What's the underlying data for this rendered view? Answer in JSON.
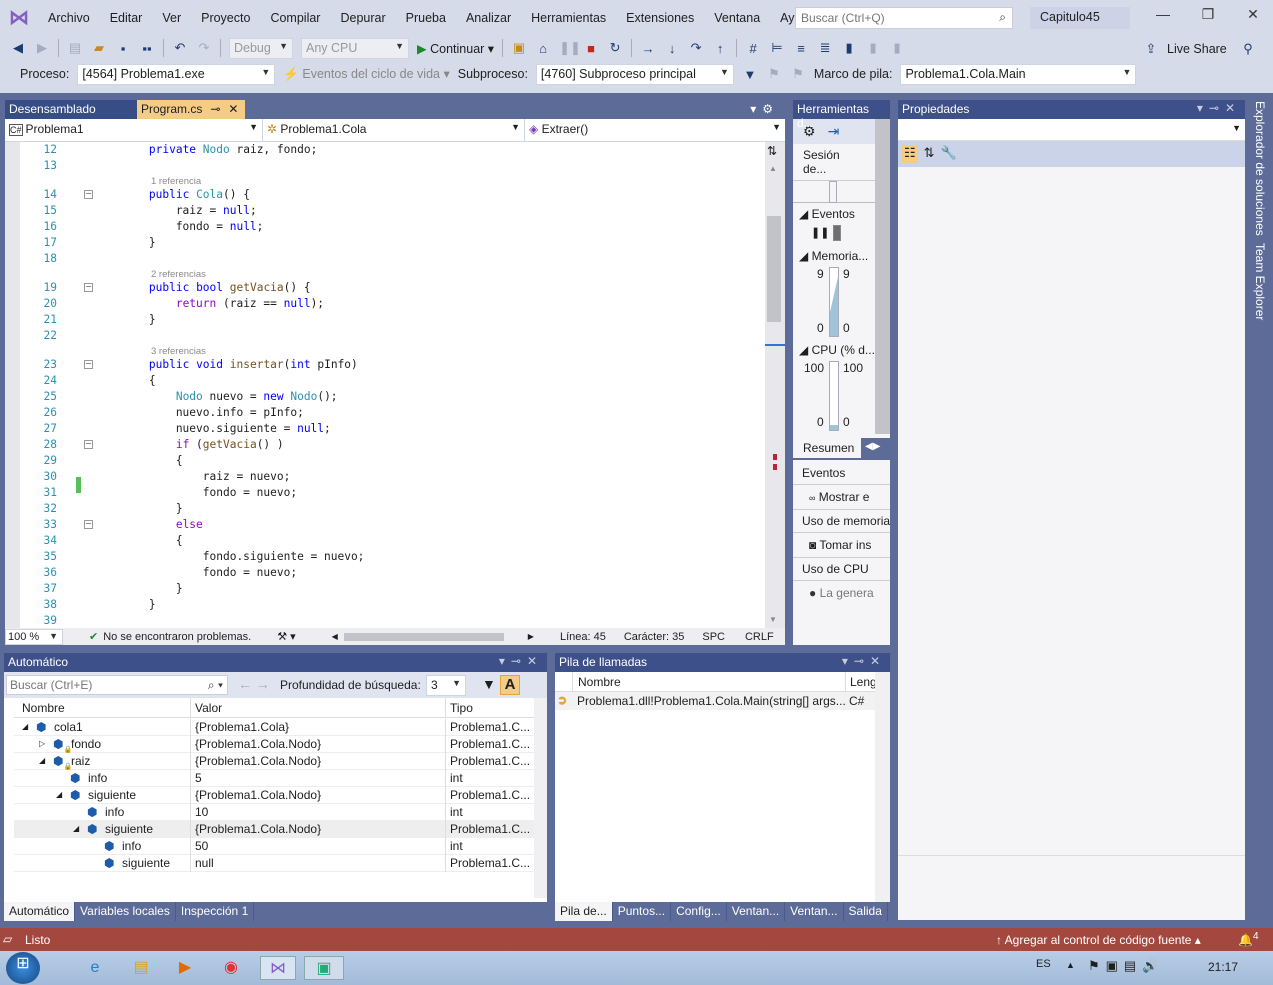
{
  "menu": {
    "items": [
      "Archivo",
      "Editar",
      "Ver",
      "Proyecto",
      "Compilar",
      "Depurar",
      "Prueba",
      "Analizar",
      "Herramientas",
      "Extensiones",
      "Ventana",
      "Ayuda"
    ],
    "search_placeholder": "Buscar (Ctrl+Q)",
    "project": "Capitulo45"
  },
  "toolbar": {
    "config": "Debug",
    "platform": "Any CPU",
    "continue": "Continuar",
    "live_share": "Live Share"
  },
  "debugbar": {
    "process_label": "Proceso:",
    "process": "[4564] Problema1.exe",
    "lifecycle": "Eventos del ciclo de vida",
    "thread_label": "Subproceso:",
    "thread": "[4760] Subproceso principal",
    "frame_label": "Marco de pila:",
    "frame": "Problema1.Cola.Main"
  },
  "editor": {
    "tabs": [
      {
        "label": "Desensamblado"
      },
      {
        "label": "Program.cs",
        "active": true
      }
    ],
    "nav": [
      "Problema1",
      "Problema1.Cola",
      "Extraer()"
    ],
    "lines": [
      {
        "n": "12",
        "t": [
          [
            "        "
          ],
          [
            "private",
            "k"
          ],
          [
            " "
          ],
          [
            "Nodo",
            "t"
          ],
          [
            " raiz, fondo;"
          ]
        ]
      },
      {
        "n": "13",
        "t": []
      },
      {
        "lens": "1 referencia"
      },
      {
        "n": "14",
        "fold": true,
        "t": [
          [
            "        "
          ],
          [
            "public",
            "k"
          ],
          [
            " "
          ],
          [
            "Cola",
            "t"
          ],
          [
            "() {"
          ]
        ]
      },
      {
        "n": "15",
        "t": [
          [
            "            raiz = "
          ],
          [
            "null",
            "k"
          ],
          [
            ";"
          ]
        ]
      },
      {
        "n": "16",
        "t": [
          [
            "            fondo = "
          ],
          [
            "null",
            "k"
          ],
          [
            ";"
          ]
        ]
      },
      {
        "n": "17",
        "t": [
          [
            "        }"
          ]
        ]
      },
      {
        "n": "18",
        "t": []
      },
      {
        "lens": "2 referencias"
      },
      {
        "n": "19",
        "fold": true,
        "t": [
          [
            "        "
          ],
          [
            "public",
            "k"
          ],
          [
            " "
          ],
          [
            "bool",
            "k"
          ],
          [
            " "
          ],
          [
            "getVacia",
            "m"
          ],
          [
            "() {"
          ]
        ]
      },
      {
        "n": "20",
        "t": [
          [
            "            "
          ],
          [
            "return",
            "c"
          ],
          [
            " (raiz == "
          ],
          [
            "null",
            "k"
          ],
          [
            ");"
          ]
        ]
      },
      {
        "n": "21",
        "t": [
          [
            "        }"
          ]
        ]
      },
      {
        "n": "22",
        "t": []
      },
      {
        "lens": "3 referencias"
      },
      {
        "n": "23",
        "fold": true,
        "t": [
          [
            "        "
          ],
          [
            "public",
            "k"
          ],
          [
            " "
          ],
          [
            "void",
            "k"
          ],
          [
            " "
          ],
          [
            "insertar",
            "m"
          ],
          [
            "("
          ],
          [
            "int",
            "k"
          ],
          [
            " pInfo)"
          ]
        ]
      },
      {
        "n": "24",
        "t": [
          [
            "        {"
          ]
        ]
      },
      {
        "n": "25",
        "t": [
          [
            "            "
          ],
          [
            "Nodo",
            "t"
          ],
          [
            " nuevo = "
          ],
          [
            "new",
            "k"
          ],
          [
            " "
          ],
          [
            "Nodo",
            "t"
          ],
          [
            "();"
          ]
        ]
      },
      {
        "n": "26",
        "t": [
          [
            "            nuevo.info = pInfo;"
          ]
        ]
      },
      {
        "n": "27",
        "t": [
          [
            "            nuevo.siguiente = "
          ],
          [
            "null",
            "k"
          ],
          [
            ";"
          ]
        ]
      },
      {
        "n": "28",
        "fold": true,
        "t": [
          [
            "            "
          ],
          [
            "if",
            "c"
          ],
          [
            " ("
          ],
          [
            "getVacia",
            "m"
          ],
          [
            "() )"
          ]
        ]
      },
      {
        "n": "29",
        "t": [
          [
            "            {"
          ]
        ]
      },
      {
        "n": "30",
        "t": [
          [
            "                raiz = nuevo;"
          ]
        ]
      },
      {
        "n": "31",
        "t": [
          [
            "                fondo = nuevo;"
          ]
        ]
      },
      {
        "n": "32",
        "t": [
          [
            "            }"
          ]
        ]
      },
      {
        "n": "33",
        "fold": true,
        "t": [
          [
            "            "
          ],
          [
            "else",
            "c"
          ]
        ]
      },
      {
        "n": "34",
        "t": [
          [
            "            {"
          ]
        ]
      },
      {
        "n": "35",
        "t": [
          [
            "                fondo.siguiente = nuevo;"
          ]
        ]
      },
      {
        "n": "36",
        "t": [
          [
            "                fondo = nuevo;"
          ]
        ]
      },
      {
        "n": "37",
        "t": [
          [
            "            }"
          ]
        ]
      },
      {
        "n": "38",
        "t": [
          [
            "        }"
          ]
        ]
      },
      {
        "n": "39",
        "t": []
      }
    ],
    "status": {
      "zoom": "100 %",
      "issues": "No se encontraron problemas.",
      "line": "Línea: 45",
      "char": "Carácter: 35",
      "spc": "SPC",
      "crlf": "CRLF"
    }
  },
  "diag": {
    "title": "Herramientas d...",
    "session": "Sesión de...",
    "events": "Eventos",
    "memory": "Memoria...",
    "mem_max_l": "9",
    "mem_max_r": "9",
    "mem_min_l": "0",
    "mem_min_r": "0",
    "cpu": "CPU (% d...",
    "cpu_max_l": "100",
    "cpu_max_r": "100",
    "cpu_min_l": "0",
    "cpu_min_r": "0",
    "tab": "Resumen",
    "s1": "Eventos",
    "s1a": "Mostrar e",
    "s2": "Uso de memoria",
    "s2a": "Tomar ins",
    "s3": "Uso de CPU",
    "s3a": "La genera"
  },
  "props": {
    "title": "Propiedades"
  },
  "side_tabs": [
    "Explorador de soluciones",
    "Team Explorer"
  ],
  "autos": {
    "title": "Automático",
    "search_placeholder": "Buscar (Ctrl+E)",
    "depth_label": "Profundidad de búsqueda:",
    "depth": "3",
    "cols": [
      "Nombre",
      "Valor",
      "Tipo"
    ],
    "rows": [
      {
        "name": "cola1",
        "value": "{Problema1.Cola}",
        "type": "Problema1.C...",
        "level": 0,
        "exp": "open"
      },
      {
        "name": "fondo",
        "value": "{Problema1.Cola.Nodo}",
        "type": "Problema1.C...",
        "level": 1,
        "exp": "closed",
        "lock": true
      },
      {
        "name": "raiz",
        "value": "{Problema1.Cola.Nodo}",
        "type": "Problema1.C...",
        "level": 1,
        "exp": "open",
        "lock": true
      },
      {
        "name": "info",
        "value": "5",
        "type": "int",
        "level": 2
      },
      {
        "name": "siguiente",
        "value": "{Problema1.Cola.Nodo}",
        "type": "Problema1.C...",
        "level": 2,
        "exp": "open"
      },
      {
        "name": "info",
        "value": "10",
        "type": "int",
        "level": 3
      },
      {
        "name": "siguiente",
        "value": "{Problema1.Cola.Nodo}",
        "type": "Problema1.C...",
        "level": 3,
        "exp": "open",
        "selected": true
      },
      {
        "name": "info",
        "value": "50",
        "type": "int",
        "level": 4
      },
      {
        "name": "siguiente",
        "value": "null",
        "type": "Problema1.C...",
        "level": 4
      }
    ],
    "tabs": [
      "Automático",
      "Variables locales",
      "Inspección 1"
    ]
  },
  "callstack": {
    "title": "Pila de llamadas",
    "cols": [
      "Nombre",
      "Leng"
    ],
    "rows": [
      {
        "name": "Problema1.dll!Problema1.Cola.Main(string[] args...",
        "lang": "C#"
      }
    ],
    "tabs": [
      "Pila de...",
      "Puntos...",
      "Config...",
      "Ventan...",
      "Ventan...",
      "Salida"
    ]
  },
  "statusbar": {
    "ready": "Listo",
    "source_control": "Agregar al control de código fuente",
    "notifications": "4"
  },
  "taskbar": {
    "lang": "ES",
    "time": "21:17"
  },
  "colors": {
    "accent": "#3e5089",
    "debug_status": "#a4483f",
    "active_tab": "#f5cc84"
  }
}
